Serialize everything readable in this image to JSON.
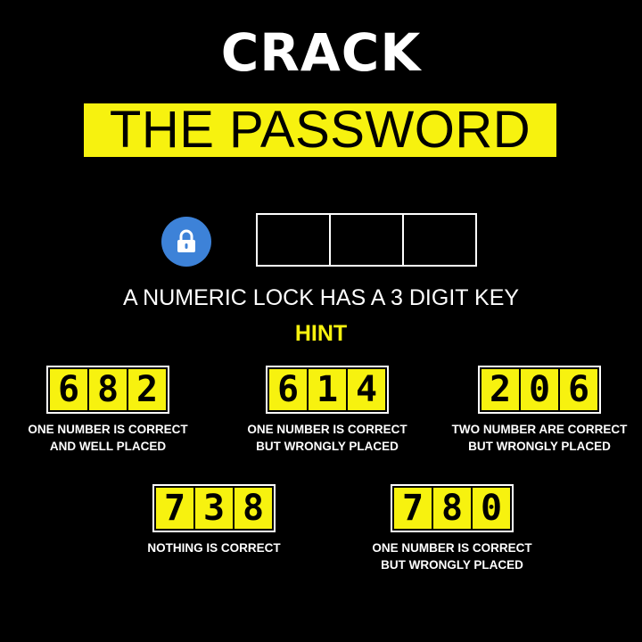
{
  "header": {
    "title_line1": "CRACK",
    "title_line2": "THE PASSWORD"
  },
  "lock": {
    "icon": "padlock-icon",
    "slots": 3
  },
  "subtitle": "A NUMERIC LOCK HAS A 3 DIGIT KEY",
  "hint_label": "HINT",
  "clues": [
    {
      "digits": [
        "6",
        "8",
        "2"
      ],
      "line1": "ONE NUMBER IS CORRECT",
      "line2": "AND WELL PLACED"
    },
    {
      "digits": [
        "6",
        "1",
        "4"
      ],
      "line1": "ONE NUMBER IS CORRECT",
      "line2": "BUT WRONGLY PLACED"
    },
    {
      "digits": [
        "2",
        "0",
        "6"
      ],
      "line1": "TWO NUMBER ARE CORRECT",
      "line2": "BUT WRONGLY PLACED"
    },
    {
      "digits": [
        "7",
        "3",
        "8"
      ],
      "line1": "NOTHING IS CORRECT",
      "line2": ""
    },
    {
      "digits": [
        "7",
        "8",
        "0"
      ],
      "line1": "ONE NUMBER IS CORRECT",
      "line2": "BUT WRONGLY PLACED"
    }
  ],
  "colors": {
    "background": "#000000",
    "accent_yellow": "#f7f20f",
    "lock_blue": "#3d82d8",
    "text_white": "#ffffff"
  }
}
